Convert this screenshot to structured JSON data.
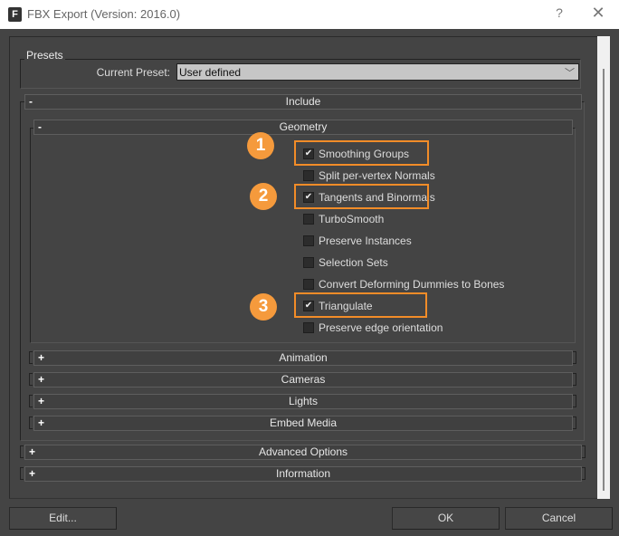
{
  "window": {
    "title": "FBX Export (Version: 2016.0)",
    "help": "?",
    "close": "✕",
    "icon": "fbx-app-icon"
  },
  "presets": {
    "group_label": "Presets",
    "current_label": "Current Preset:",
    "current_value": "User defined"
  },
  "include": {
    "label": "Include",
    "sign": "-"
  },
  "geometry": {
    "label": "Geometry",
    "sign": "-",
    "options": [
      {
        "label": "Smoothing Groups",
        "checked": true
      },
      {
        "label": "Split per-vertex Normals",
        "checked": false
      },
      {
        "label": "Tangents and Binormals",
        "checked": true
      },
      {
        "label": "TurboSmooth",
        "checked": false
      },
      {
        "label": "Preserve Instances",
        "checked": false
      },
      {
        "label": "Selection Sets",
        "checked": false
      },
      {
        "label": "Convert Deforming Dummies to Bones",
        "checked": false
      },
      {
        "label": "Triangulate",
        "checked": true
      },
      {
        "label": "Preserve edge orientation",
        "checked": false
      }
    ]
  },
  "annotations": [
    "1",
    "2",
    "3"
  ],
  "sub_rollouts": [
    {
      "label": "Animation",
      "sign": "+"
    },
    {
      "label": "Cameras",
      "sign": "+"
    },
    {
      "label": "Lights",
      "sign": "+"
    },
    {
      "label": "Embed Media",
      "sign": "+"
    }
  ],
  "top_rollouts": [
    {
      "label": "Advanced Options",
      "sign": "+"
    },
    {
      "label": "Information",
      "sign": "+"
    }
  ],
  "buttons": {
    "edit": "Edit...",
    "ok": "OK",
    "cancel": "Cancel"
  },
  "accent": "#f28c28"
}
